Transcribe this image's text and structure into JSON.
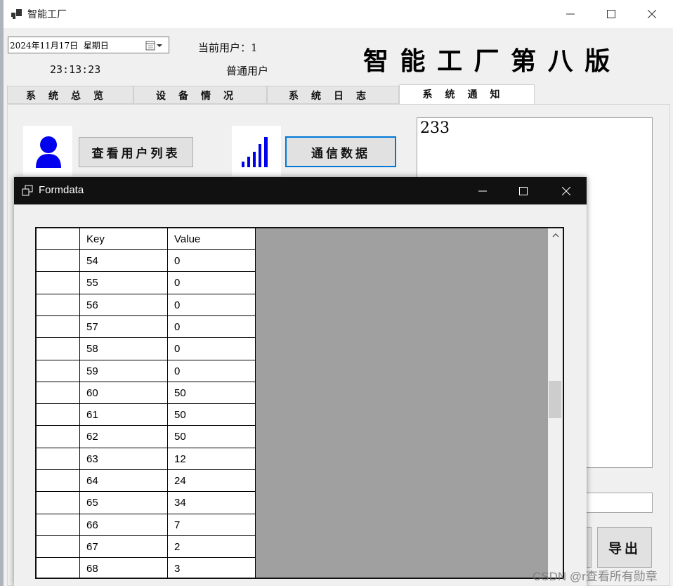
{
  "window": {
    "title": "智能工厂"
  },
  "header": {
    "date_value": "2024年11月17日  星期日",
    "time": "23:13:23",
    "current_user_label": "当前用户：1",
    "user_role": "普通用户",
    "app_title": "智 能 工 厂 第 八 版"
  },
  "tabs": [
    {
      "label": "系统总览",
      "active": false
    },
    {
      "label": "设备情况",
      "active": false
    },
    {
      "label": "系统日志",
      "active": false
    },
    {
      "label": "系统通知",
      "active": true
    }
  ],
  "main": {
    "view_users_button": "查看用户列表",
    "comm_data_button": "通信数据",
    "notice_text": "233",
    "export_button": "导出"
  },
  "dialog": {
    "title": "Formdata",
    "columns": [
      "",
      "Key",
      "Value"
    ],
    "rows": [
      {
        "key": "54",
        "value": "0"
      },
      {
        "key": "55",
        "value": "0"
      },
      {
        "key": "56",
        "value": "0"
      },
      {
        "key": "57",
        "value": "0"
      },
      {
        "key": "58",
        "value": "0"
      },
      {
        "key": "59",
        "value": "0"
      },
      {
        "key": "60",
        "value": "50"
      },
      {
        "key": "61",
        "value": "50"
      },
      {
        "key": "62",
        "value": "50"
      },
      {
        "key": "63",
        "value": "12"
      },
      {
        "key": "64",
        "value": "24"
      },
      {
        "key": "65",
        "value": "34"
      },
      {
        "key": "66",
        "value": "7"
      },
      {
        "key": "67",
        "value": "2"
      },
      {
        "key": "68",
        "value": "3"
      }
    ]
  },
  "watermark": "CSDN @r查看所有勋章",
  "colors": {
    "accent_blue": "#0000ee",
    "focus_border": "#0078d7",
    "dialog_titlebar": "#111111",
    "grid_empty": "#a0a0a0",
    "form_bg": "#f0f0f0"
  }
}
